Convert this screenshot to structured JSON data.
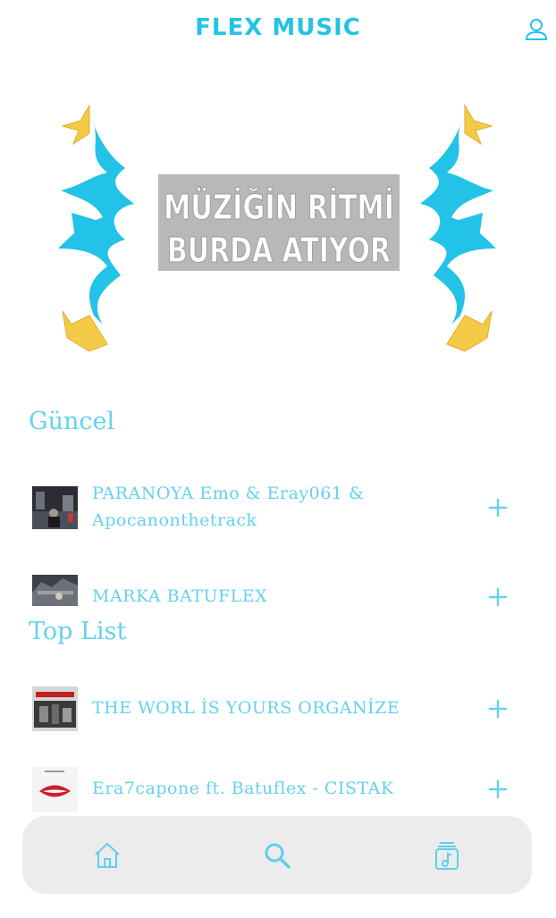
{
  "header": {
    "brand": "FLEX MUSIC",
    "profile_icon": "user-icon"
  },
  "hero": {
    "line1": "MÜZİĞİN RİTMİ",
    "line2": "BURDA ATIYOR"
  },
  "sections": [
    {
      "title": "Güncel",
      "tracks": [
        {
          "title": "PARANOYA Emo & Eray061 & Apocanonthetrack",
          "action_icon": "plus-icon"
        },
        {
          "title": "MARKA BATUFLEX",
          "action_icon": "plus-icon"
        }
      ]
    },
    {
      "title": "Top List",
      "tracks": [
        {
          "title": "THE WORL İS YOURS  ORGANİZE",
          "action_icon": "plus-icon"
        },
        {
          "title": "Era7capone ft. Batuflex - CISTAK",
          "action_icon": "plus-icon"
        }
      ]
    }
  ],
  "nav": {
    "items": [
      {
        "icon": "home-icon"
      },
      {
        "icon": "search-icon"
      },
      {
        "icon": "library-icon"
      }
    ]
  },
  "colors": {
    "accent": "#22c3e6",
    "text_accent": "#63d2ee",
    "hero_gold": "#f3cb48",
    "hero_text_bg": "#b8b8b8",
    "nav_bg": "#ececec",
    "nav_icon": "#5ed0ea"
  }
}
